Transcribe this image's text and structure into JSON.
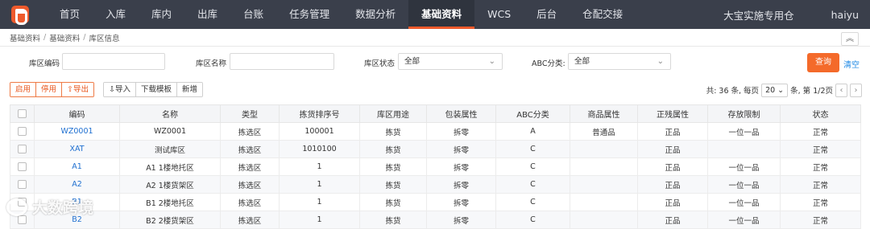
{
  "nav": {
    "items": [
      {
        "label": "首页",
        "active": false
      },
      {
        "label": "入库",
        "active": false
      },
      {
        "label": "库内",
        "active": false
      },
      {
        "label": "出库",
        "active": false
      },
      {
        "label": "台账",
        "active": false
      },
      {
        "label": "任务管理",
        "active": false
      },
      {
        "label": "数据分析",
        "active": false
      },
      {
        "label": "基础资料",
        "active": true
      },
      {
        "label": "WCS",
        "active": false
      },
      {
        "label": "后台",
        "active": false
      },
      {
        "label": "仓配交接",
        "active": false
      }
    ],
    "warehouse": "大宝实施专用仓",
    "user": "haiyu"
  },
  "breadcrumb": [
    "基础资料",
    "基础资料",
    "库区信息"
  ],
  "filters": {
    "code_label": "库区编码",
    "code_value": "",
    "name_label": "库区名称",
    "name_value": "",
    "status_label": "库区状态",
    "status_value": "全部",
    "abc_label": "ABC分类:",
    "abc_value": "全部",
    "query": "查询",
    "clear": "清空"
  },
  "toolbar": {
    "enable": "启用",
    "disable": "停用",
    "export": "导出",
    "import": "导入",
    "download_template": "下载模板",
    "add": "新增"
  },
  "pager": {
    "total_text": "共: 36 条, 每页",
    "page_size": "20",
    "page_text": "条, 第 1/2页"
  },
  "table": {
    "headers": [
      "编码",
      "名称",
      "类型",
      "拣货排序号",
      "库区用途",
      "包装属性",
      "ABC分类",
      "商品属性",
      "正残属性",
      "存放限制",
      "状态"
    ],
    "rows": [
      [
        "WZ0001",
        "WZ0001",
        "拣选区",
        "100001",
        "拣货",
        "拆零",
        "A",
        "普通品",
        "正品",
        "一位一品",
        "正常"
      ],
      [
        "XAT",
        "测试库区",
        "拣选区",
        "1010100",
        "拣货",
        "拆零",
        "C",
        "",
        "正品",
        "",
        "正常"
      ],
      [
        "A1",
        "A1 1楼地托区",
        "拣选区",
        "1",
        "拣货",
        "拆零",
        "C",
        "",
        "正品",
        "一位一品",
        "正常"
      ],
      [
        "A2",
        "A2 1楼货架区",
        "拣选区",
        "1",
        "拣货",
        "拆零",
        "C",
        "",
        "正品",
        "一位一品",
        "正常"
      ],
      [
        "B1",
        "B1 2楼地托区",
        "拣选区",
        "1",
        "拣货",
        "拆零",
        "C",
        "",
        "正品",
        "一位一品",
        "正常"
      ],
      [
        "B2",
        "B2 2楼货架区",
        "拣选区",
        "1",
        "拣货",
        "拆零",
        "C",
        "",
        "正品",
        "一位一品",
        "正常"
      ]
    ]
  },
  "watermark": "大数跨境",
  "colors": {
    "nav_bg": "#3a3f4b",
    "accent": "#ee5a2c",
    "link": "#1e6fd0"
  }
}
